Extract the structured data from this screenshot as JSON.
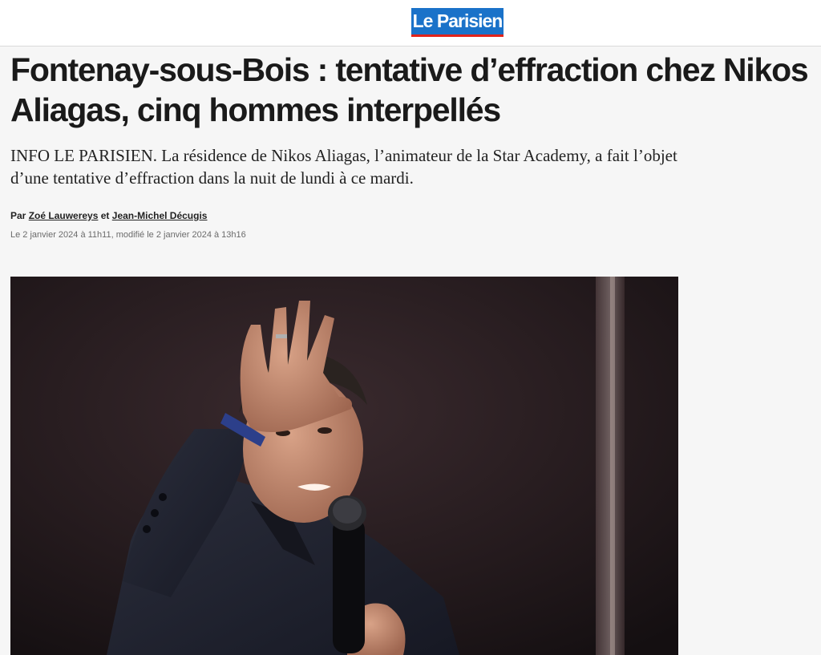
{
  "site": {
    "logo_text": "Le Parisien",
    "logo_color": "#1a72c9",
    "logo_accent": "#e2231a"
  },
  "article": {
    "headline": "Fontenay-sous-Bois : tentative d’effraction chez Nikos Aliagas, cinq hommes interpellés",
    "lede": "INFO LE PARISIEN. La résidence de Nikos Aliagas, l’animateur de la Star Academy, a fait l’objet d’une tentative d’effraction dans la nuit de lundi à ce mardi.",
    "byline": {
      "prefix": "Par",
      "author1": "Zoé Lauwereys",
      "conjunction": "et",
      "author2": "Jean-Michel Décugis"
    },
    "dates": "Le 2 janvier 2024 à 11h11, modifié le 2 janvier 2024 à 13h16"
  },
  "photo": {
    "subject": "man-waving-with-microphone-on-stage"
  }
}
